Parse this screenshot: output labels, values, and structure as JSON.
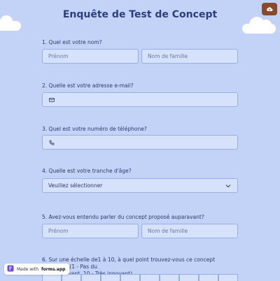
{
  "title": "Enquête de Test de Concept",
  "questions": {
    "q1": {
      "num": "1.",
      "label": "Quel est votre nom?",
      "first_placeholder": "Prénom",
      "last_placeholder": "Nom de famille"
    },
    "q2": {
      "num": "2.",
      "label": "Quelle est votre adresse e-mail?"
    },
    "q3": {
      "num": "3.",
      "label": "Quel est votre numéro de téléphone?"
    },
    "q4": {
      "num": "4.",
      "label": "Quelle est votre tranche d'âge?",
      "select_value": "Veuillez sélectionner"
    },
    "q5": {
      "num": "5.",
      "label": "Avez-vous entendu parler du concept proposé auparavant?",
      "first_placeholder": "Prénom",
      "last_placeholder": "Nom de famille"
    },
    "q6": {
      "num": "6.",
      "label_line1": "Sur une échelle de1 à 10, à quel point trouvez-vous ce concept innovant? (1 - Pas du",
      "label_line2": "novant, 10 - Très innovant)"
    }
  },
  "badge": {
    "made_with": "Made with",
    "brand": "forms.app"
  },
  "icons": {
    "email": "email-icon",
    "phone": "phone-icon",
    "chevron": "chevron-down-icon",
    "top_right": "cloud-upload-icon"
  },
  "colors": {
    "background": "#c3d3f7",
    "field": "#d6e1fb",
    "border": "#98aee6",
    "title": "#2b3f7c",
    "badge_top": "#8a4a2a"
  }
}
